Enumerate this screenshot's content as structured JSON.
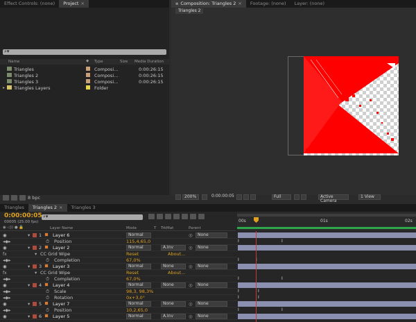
{
  "top_tabs_left": [
    "Effect Controls: (none)",
    "Project"
  ],
  "top_tabs_right": [
    "Composition: Triangles 2",
    "Footage: (none)",
    "Layer: (none)"
  ],
  "comp_subtab": "Triangles 2",
  "project": {
    "columns": [
      "Name",
      "Type",
      "Size",
      "Media Duration"
    ],
    "items": [
      {
        "name": "Triangles",
        "type": "Composi...",
        "size": "",
        "duration": "0:00:26:15",
        "color": "#c9a07a"
      },
      {
        "name": "Triangles 2",
        "type": "Composi...",
        "size": "",
        "duration": "0:00:26:15",
        "color": "#c9a07a"
      },
      {
        "name": "Triangles 3",
        "type": "Composi...",
        "size": "",
        "duration": "0:00:26:15",
        "color": "#c9a07a"
      },
      {
        "name": "Triangles Layers",
        "type": "Folder",
        "size": "",
        "duration": "",
        "color": "#e8d44d"
      }
    ],
    "bpc": "8 bpc"
  },
  "viewer_controls": {
    "zoom": "200%",
    "timecode": "0:00:00:05",
    "resolution": "Full",
    "camera": "Active Camera",
    "view": "1 View"
  },
  "timeline_tabs": [
    "Triangles",
    "Triangles 2",
    "Triangles 3"
  ],
  "timeline": {
    "current_time": "0:00:00:05",
    "frame_info": "00005 (25.00 fps)",
    "columns": [
      "Layer Name",
      "Mode",
      "T",
      "TrkMat",
      "Parent"
    ],
    "ruler": [
      "00s",
      "01s",
      "02s"
    ],
    "rows": [
      {
        "num": "1",
        "name": "Layer 6",
        "mode": "Normal",
        "trkmat": "",
        "parent": "None",
        "kind": "layer"
      },
      {
        "name": "Position",
        "value": "115,4,65,0",
        "kind": "prop"
      },
      {
        "num": "2",
        "name": "Layer 2",
        "mode": "Normal",
        "trkmat": "A.Inv",
        "parent": "None",
        "kind": "layer"
      },
      {
        "name": "CC Grid Wipe",
        "value": "Reset",
        "extra": "About...",
        "kind": "effect"
      },
      {
        "name": "Completion",
        "value": "67,0%",
        "kind": "prop"
      },
      {
        "num": "3",
        "name": "Layer 3",
        "mode": "Normal",
        "trkmat": "None",
        "parent": "None",
        "kind": "layer"
      },
      {
        "name": "CC Grid Wipe",
        "value": "Reset",
        "extra": "About...",
        "kind": "effect"
      },
      {
        "name": "Completion",
        "value": "67,0%",
        "kind": "prop"
      },
      {
        "num": "4",
        "name": "Layer 4",
        "mode": "Normal",
        "trkmat": "None",
        "parent": "None",
        "kind": "layer"
      },
      {
        "name": "Scale",
        "value": "98,3, 98,3%",
        "kind": "prop"
      },
      {
        "name": "Rotation",
        "value": "0x+3,0°",
        "kind": "prop"
      },
      {
        "num": "5",
        "name": "Layer 7",
        "mode": "Normal",
        "trkmat": "None",
        "parent": "None",
        "kind": "layer"
      },
      {
        "name": "Position",
        "value": "10,2,65,0",
        "kind": "prop"
      },
      {
        "num": "6",
        "name": "Layer 5",
        "mode": "Normal",
        "trkmat": "A.Inv",
        "parent": "None",
        "kind": "layer"
      }
    ]
  }
}
